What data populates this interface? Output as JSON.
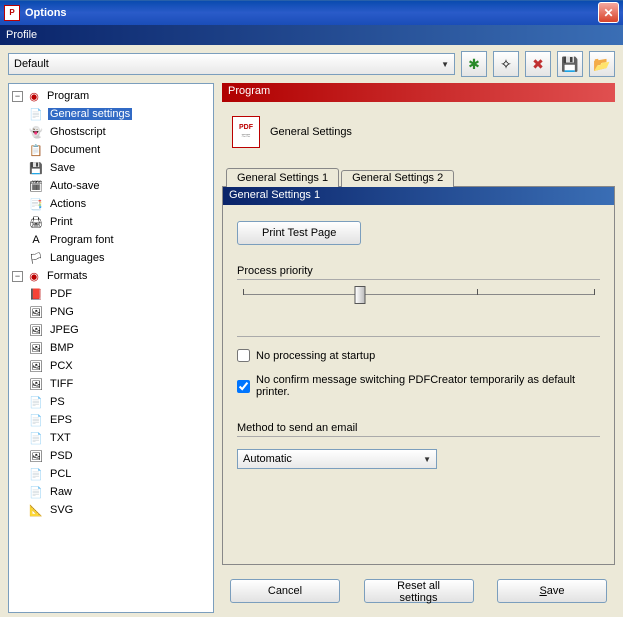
{
  "window": {
    "title": "Options"
  },
  "profile": {
    "label": "Profile",
    "selected": "Default",
    "buttons": {
      "add": "✱",
      "dup": "✧",
      "del": "✖",
      "save_disk": "💾",
      "folder": "📂"
    }
  },
  "tree": {
    "program": {
      "label": "Program",
      "items": [
        {
          "label": "General settings",
          "icon": "📄",
          "selected": true
        },
        {
          "label": "Ghostscript",
          "icon": "👻"
        },
        {
          "label": "Document",
          "icon": "📋"
        },
        {
          "label": "Save",
          "icon": "💾"
        },
        {
          "label": "Auto-save",
          "icon": "🗓"
        },
        {
          "label": "Actions",
          "icon": "📑"
        },
        {
          "label": "Print",
          "icon": "🖨"
        },
        {
          "label": "Program font",
          "icon": "A"
        },
        {
          "label": "Languages",
          "icon": "🏳"
        }
      ]
    },
    "formats": {
      "label": "Formats",
      "items": [
        {
          "label": "PDF",
          "icon": "📕"
        },
        {
          "label": "PNG",
          "icon": "🖼"
        },
        {
          "label": "JPEG",
          "icon": "🖼"
        },
        {
          "label": "BMP",
          "icon": "🖼"
        },
        {
          "label": "PCX",
          "icon": "🖼"
        },
        {
          "label": "TIFF",
          "icon": "🖼"
        },
        {
          "label": "PS",
          "icon": "📄"
        },
        {
          "label": "EPS",
          "icon": "📄"
        },
        {
          "label": "TXT",
          "icon": "📄"
        },
        {
          "label": "PSD",
          "icon": "🖼"
        },
        {
          "label": "PCL",
          "icon": "📄"
        },
        {
          "label": "Raw",
          "icon": "📄"
        },
        {
          "label": "SVG",
          "icon": "📐"
        }
      ]
    }
  },
  "content": {
    "section_header": "Program",
    "section_title": "General Settings",
    "tabs": {
      "tab1": "General Settings 1",
      "tab2": "General Settings 2"
    },
    "panel": {
      "header": "General Settings 1",
      "print_test_btn": "Print Test Page",
      "priority_label": "Process priority",
      "cb_no_processing": "No processing at startup",
      "cb_no_processing_checked": false,
      "cb_no_confirm": "No confirm message switching PDFCreator temporarily as default printer.",
      "cb_no_confirm_checked": true,
      "method_label": "Method to send an email",
      "method_value": "Automatic"
    }
  },
  "footer": {
    "cancel": "Cancel",
    "reset": "Reset all settings",
    "save": "Save"
  }
}
